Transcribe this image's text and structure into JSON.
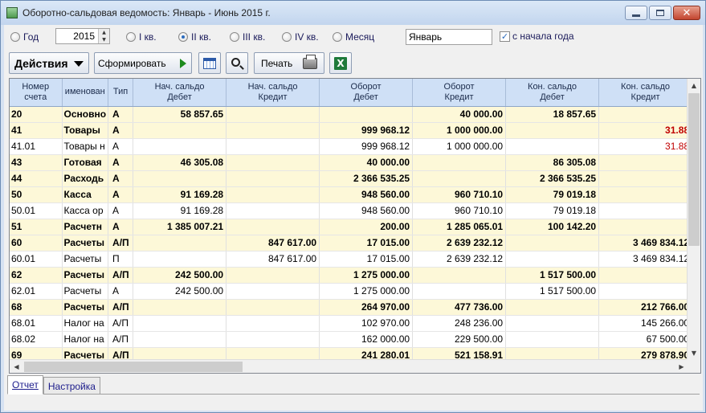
{
  "window": {
    "title": "Оборотно-сальдовая ведомость: Январь - Июнь 2015 г."
  },
  "period": {
    "year_label": "Год",
    "year_value": "2015",
    "q1_label": "I кв.",
    "q2_label": "II кв.",
    "q3_label": "III кв.",
    "q4_label": "IV кв.",
    "month_label": "Месяц",
    "selected": "II кв.",
    "month_value": "Январь",
    "from_year_start_label": "с начала года",
    "from_year_start_checked": true
  },
  "toolbar": {
    "actions_label": "Действия",
    "form_label": "Сформировать",
    "print_label": "Печать"
  },
  "grid": {
    "columns": [
      "Номер\nсчета",
      "именован",
      "Тип",
      "Нач. сальдо\nДебет",
      "Нач. сальдо\nКредит",
      "Оборот\nДебет",
      "Оборот\nКредит",
      "Кон. сальдо\nДебет",
      "Кон. сальдо\nКредит"
    ],
    "rows": [
      {
        "acct": "20",
        "name": "Основно",
        "type": "А",
        "sd": "58 857.65",
        "sc": "",
        "td": "",
        "tc": "40 000.00",
        "ed": "18 857.65",
        "ec": "",
        "bold": true
      },
      {
        "acct": "41",
        "name": "Товары",
        "type": "А",
        "sd": "",
        "sc": "",
        "td": "999 968.12",
        "tc": "1 000 000.00",
        "ed": "",
        "ec": "31.88",
        "bold": true,
        "red": true
      },
      {
        "acct": "41.01",
        "name": "Товары н",
        "type": "А",
        "sd": "",
        "sc": "",
        "td": "999 968.12",
        "tc": "1 000 000.00",
        "ed": "",
        "ec": "31.88",
        "bold": false,
        "red": true
      },
      {
        "acct": "43",
        "name": "Готовая",
        "type": "А",
        "sd": "46 305.08",
        "sc": "",
        "td": "40 000.00",
        "tc": "",
        "ed": "86 305.08",
        "ec": "",
        "bold": true
      },
      {
        "acct": "44",
        "name": "Расходь",
        "type": "А",
        "sd": "",
        "sc": "",
        "td": "2 366 535.25",
        "tc": "",
        "ed": "2 366 535.25",
        "ec": "",
        "bold": true
      },
      {
        "acct": "50",
        "name": "Касса",
        "type": "А",
        "sd": "91 169.28",
        "sc": "",
        "td": "948 560.00",
        "tc": "960 710.10",
        "ed": "79 019.18",
        "ec": "",
        "bold": true
      },
      {
        "acct": "50.01",
        "name": "Касса ор",
        "type": "А",
        "sd": "91 169.28",
        "sc": "",
        "td": "948 560.00",
        "tc": "960 710.10",
        "ed": "79 019.18",
        "ec": "",
        "bold": false
      },
      {
        "acct": "51",
        "name": "Расчетн",
        "type": "А",
        "sd": "1 385 007.21",
        "sc": "",
        "td": "200.00",
        "tc": "1 285 065.01",
        "ed": "100 142.20",
        "ec": "",
        "bold": true
      },
      {
        "acct": "60",
        "name": "Расчеты",
        "type": "А/П",
        "sd": "",
        "sc": "847 617.00",
        "td": "17 015.00",
        "tc": "2 639 232.12",
        "ed": "",
        "ec": "3 469 834.12",
        "bold": true
      },
      {
        "acct": "60.01",
        "name": "Расчеты",
        "type": "П",
        "sd": "",
        "sc": "847 617.00",
        "td": "17 015.00",
        "tc": "2 639 232.12",
        "ed": "",
        "ec": "3 469 834.12",
        "bold": false
      },
      {
        "acct": "62",
        "name": "Расчеты",
        "type": "А/П",
        "sd": "242 500.00",
        "sc": "",
        "td": "1 275 000.00",
        "tc": "",
        "ed": "1 517 500.00",
        "ec": "",
        "bold": true
      },
      {
        "acct": "62.01",
        "name": "Расчеты",
        "type": "А",
        "sd": "242 500.00",
        "sc": "",
        "td": "1 275 000.00",
        "tc": "",
        "ed": "1 517 500.00",
        "ec": "",
        "bold": false
      },
      {
        "acct": "68",
        "name": "Расчеты",
        "type": "А/П",
        "sd": "",
        "sc": "",
        "td": "264 970.00",
        "tc": "477 736.00",
        "ed": "",
        "ec": "212 766.00",
        "bold": true
      },
      {
        "acct": "68.01",
        "name": "Налог на",
        "type": "А/П",
        "sd": "",
        "sc": "",
        "td": "102 970.00",
        "tc": "248 236.00",
        "ed": "",
        "ec": "145 266.00",
        "bold": false
      },
      {
        "acct": "68.02",
        "name": "Налог на",
        "type": "А/П",
        "sd": "",
        "sc": "",
        "td": "162 000.00",
        "tc": "229 500.00",
        "ed": "",
        "ec": "67 500.00",
        "bold": false
      },
      {
        "acct": "69",
        "name": "Расчеты",
        "type": "А/П",
        "sd": "",
        "sc": "",
        "td": "241 280.01",
        "tc": "521 158.91",
        "ed": "",
        "ec": "279 878.90",
        "bold": true
      }
    ]
  },
  "tabs": {
    "report": "Отчет",
    "settings": "Настройка"
  },
  "colors": {
    "header_bg": "#cfe0f6",
    "bold_row_bg": "#fdf8d8",
    "negative_text": "#c00000"
  }
}
